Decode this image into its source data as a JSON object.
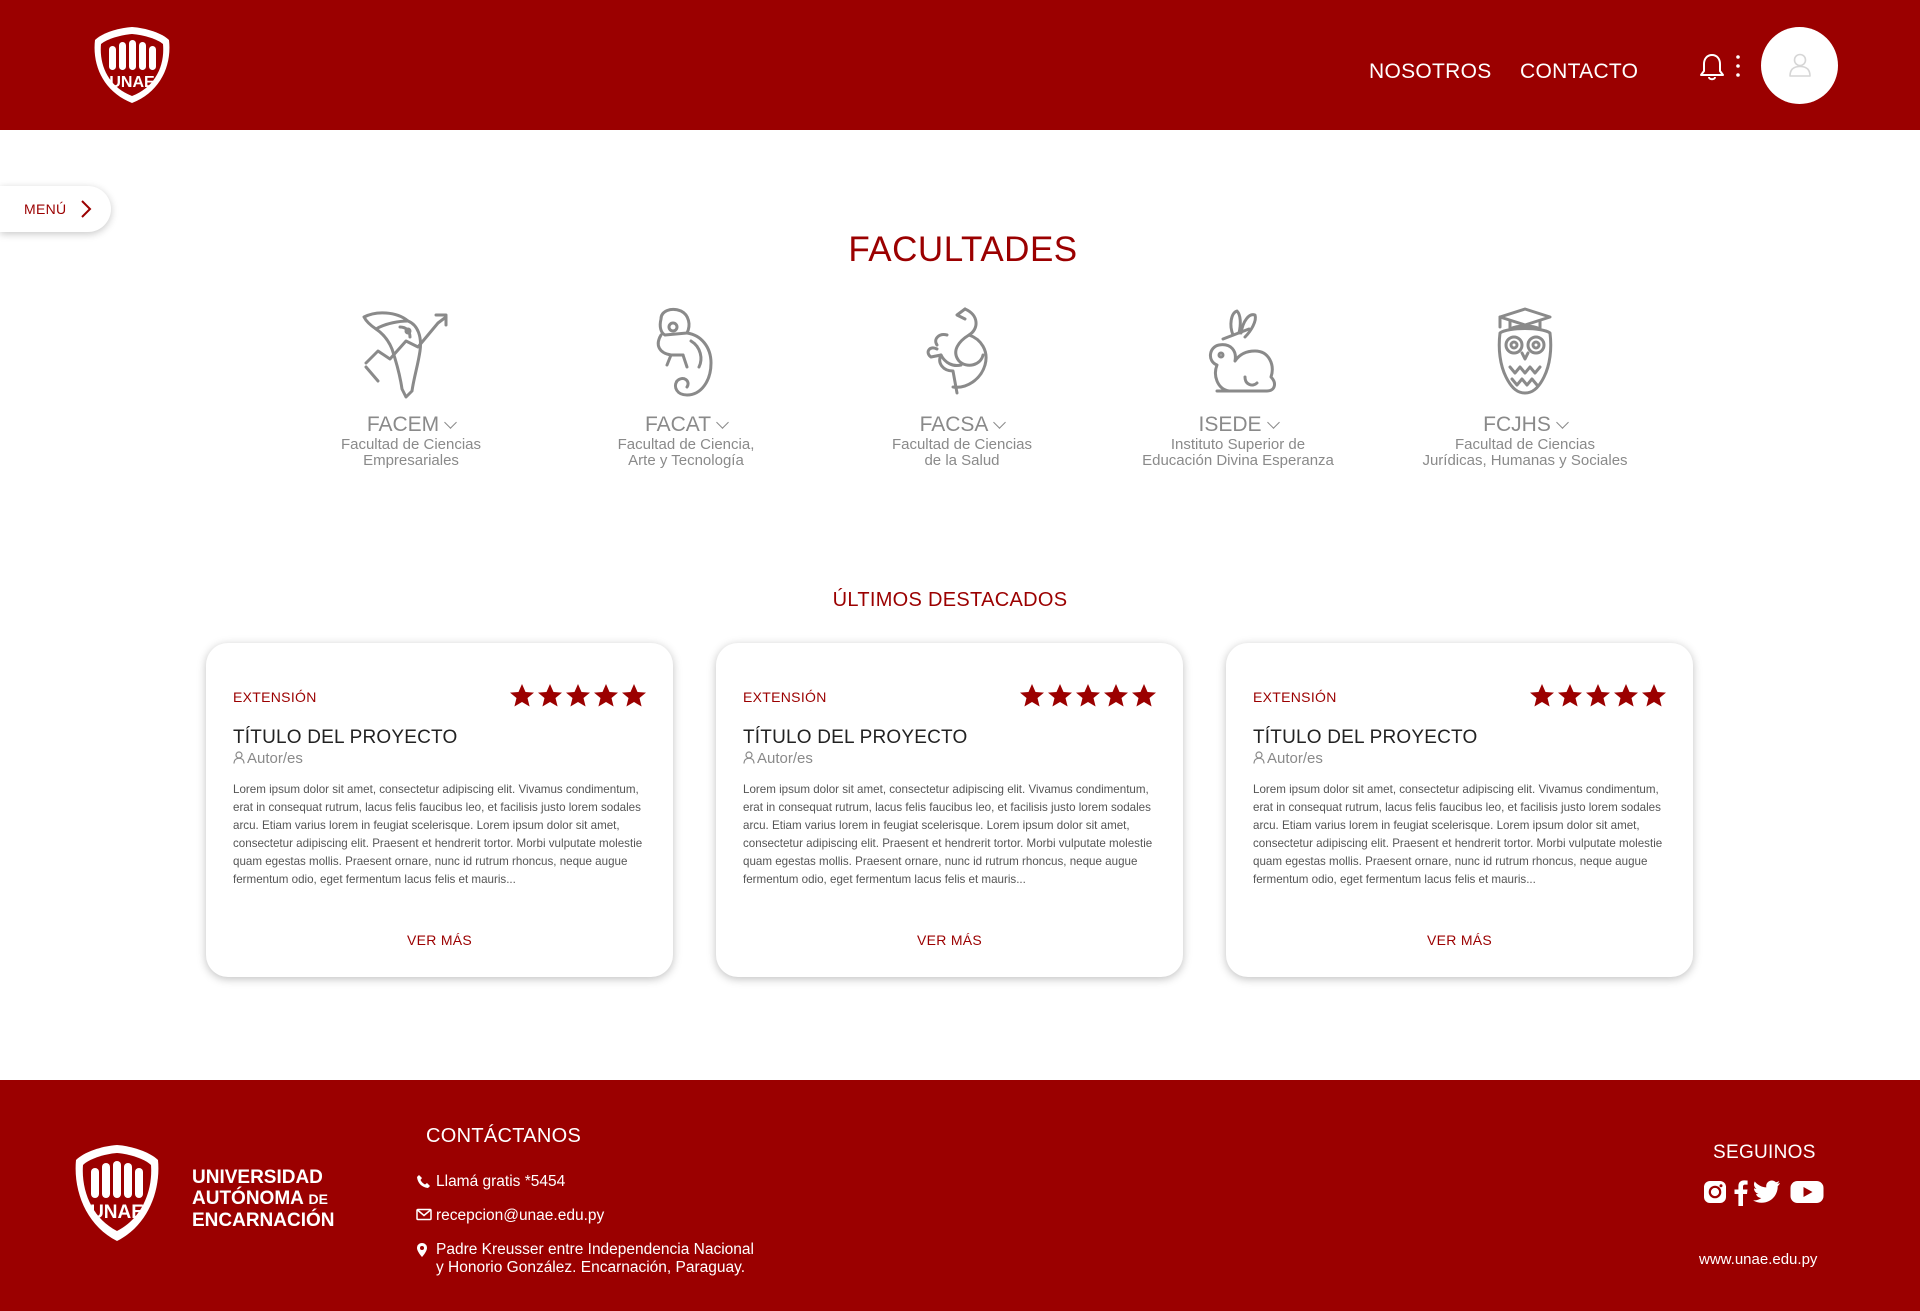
{
  "header": {
    "logo_text": "UNAE",
    "nav": [
      "NOSOTROS",
      "CONTACTO"
    ],
    "bell_icon": "bell-icon",
    "more_icon": "kebab-menu-icon",
    "avatar_icon": "user-icon"
  },
  "menu": {
    "label": "MENÚ",
    "icon": "chevron-right-icon"
  },
  "facultades": {
    "title": "FACULTADES",
    "items": [
      {
        "abbr": "FACEM",
        "name_line1": "Facultad de Ciencias",
        "name_line2": "Empresariales",
        "icon": "toucan-growth-icon"
      },
      {
        "abbr": "FACAT",
        "name_line1": "Facultad de Ciencia,",
        "name_line2": "Arte y Tecnología",
        "icon": "chameleon-icon"
      },
      {
        "abbr": "FACSA",
        "name_line1": "Facultad de Ciencias",
        "name_line2": "de la Salud",
        "icon": "caduceus-snake-icon"
      },
      {
        "abbr": "ISEDE",
        "name_line1": "Instituto Superior de",
        "name_line2": "Educación Divina Esperanza",
        "icon": "rabbit-icon"
      },
      {
        "abbr": "FCJHS",
        "name_line1": "Facultad de Ciencias",
        "name_line2": "Jurídicas, Humanas y Sociales",
        "icon": "owl-graduate-icon"
      }
    ]
  },
  "destacados": {
    "title": "ÚLTIMOS DESTACADOS",
    "cards": [
      {
        "category": "EXTENSIÓN",
        "rating": 5,
        "title": "TÍTULO DEL PROYECTO",
        "author": "Autor/es",
        "body": "Lorem ipsum dolor sit amet, consectetur adipiscing elit. Vivamus condimentum, erat in consequat rutrum, lacus felis faucibus leo, et facilisis justo lorem sodales arcu. Etiam varius lorem in feugiat scelerisque. Lorem ipsum dolor sit amet, consectetur adipiscing elit. Praesent et hendrerit tortor. Morbi vulputate molestie quam egestas mollis. Praesent ornare, nunc id rutrum rhoncus, neque augue fermentum odio, eget fermentum lacus felis et mauris...",
        "more": "VER MÁS"
      },
      {
        "category": "EXTENSIÓN",
        "rating": 5,
        "title": "TÍTULO DEL PROYECTO",
        "author": "Autor/es",
        "body": "Lorem ipsum dolor sit amet, consectetur adipiscing elit. Vivamus condimentum, erat in consequat rutrum, lacus felis faucibus leo, et facilisis justo lorem sodales arcu. Etiam varius lorem in feugiat scelerisque. Lorem ipsum dolor sit amet, consectetur adipiscing elit. Praesent et hendrerit tortor. Morbi vulputate molestie quam egestas mollis. Praesent ornare, nunc id rutrum rhoncus, neque augue fermentum odio, eget fermentum lacus felis et mauris...",
        "more": "VER MÁS"
      },
      {
        "category": "EXTENSIÓN",
        "rating": 5,
        "title": "TÍTULO DEL PROYECTO",
        "author": "Autor/es",
        "body": "Lorem ipsum dolor sit amet, consectetur adipiscing elit. Vivamus condimentum, erat in consequat rutrum, lacus felis faucibus leo, et facilisis justo lorem sodales arcu. Etiam varius lorem in feugiat scelerisque. Lorem ipsum dolor sit amet, consectetur adipiscing elit. Praesent et hendrerit tortor. Morbi vulputate molestie quam egestas mollis. Praesent ornare, nunc id rutrum rhoncus, neque augue fermentum odio, eget fermentum lacus felis et mauris...",
        "more": "VER MÁS"
      }
    ]
  },
  "footer": {
    "logo_text": "UNAE",
    "university_line1": "UNIVERSIDAD",
    "university_line2": "AUTÓNOMA",
    "university_line2_small": "DE",
    "university_line3": "ENCARNACIÓN",
    "contact_title": "CONTÁCTANOS",
    "phone": "Llamá gratis *5454",
    "email": "recepcion@unae.edu.py",
    "address_line1": "Padre Kreusser entre Independencia Nacional",
    "address_line2": "y Honorio González. Encarnación, Paraguay.",
    "follow_title": "SEGUINOS",
    "social": [
      "instagram-icon",
      "facebook-icon",
      "twitter-icon",
      "youtube-icon"
    ],
    "website": "www.unae.edu.py"
  },
  "colors": {
    "brand": "#9b0000",
    "muted_text": "#8a8a8a",
    "background": "#ffffff"
  }
}
